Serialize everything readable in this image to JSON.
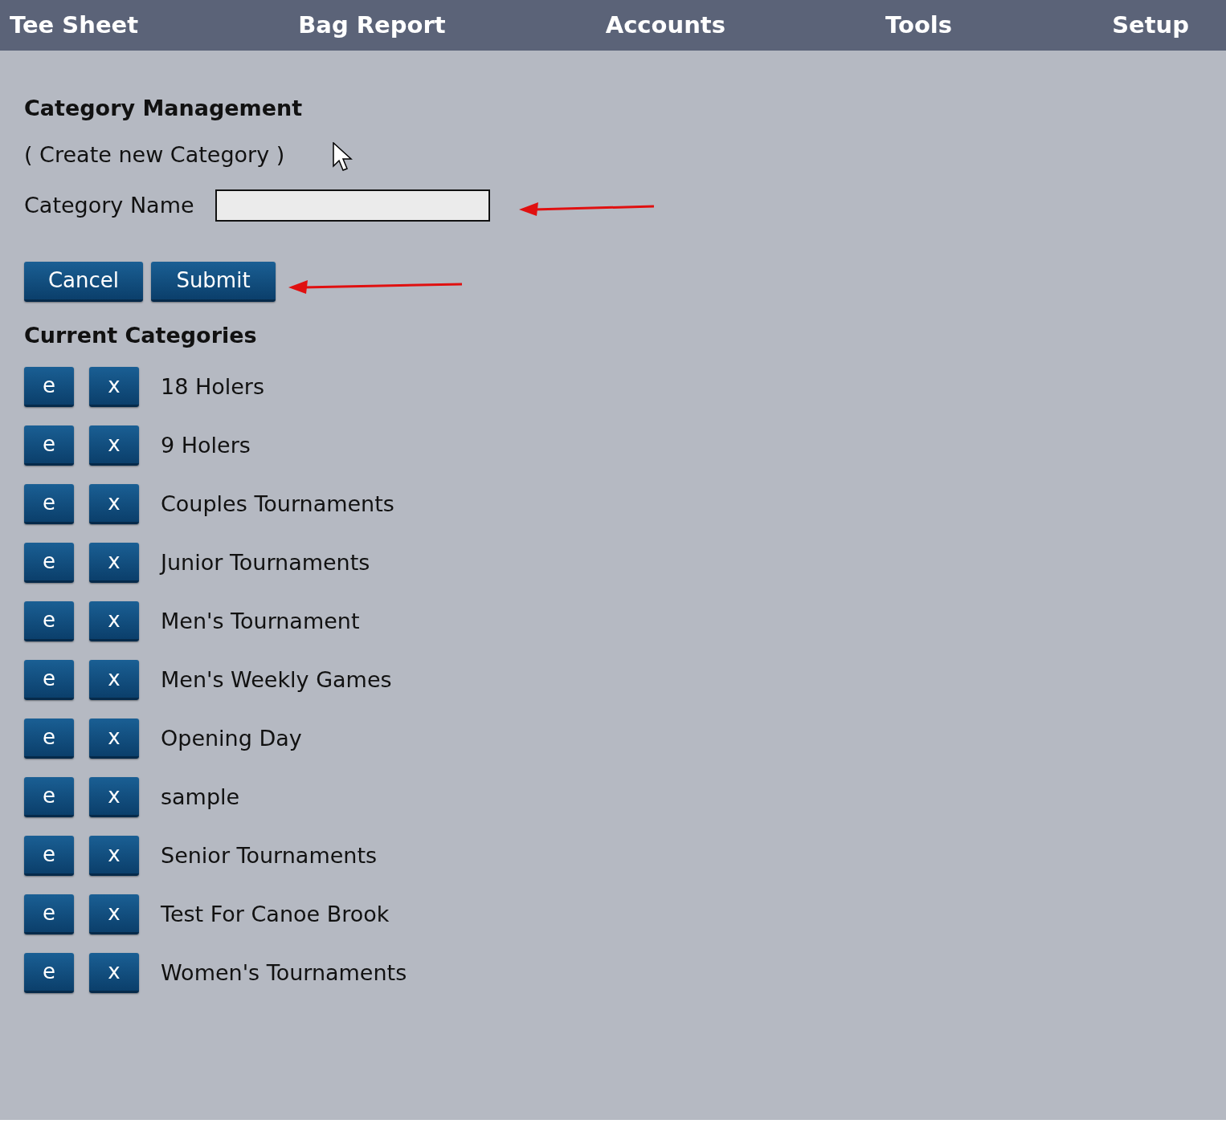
{
  "nav": [
    {
      "label": "Tee Sheet"
    },
    {
      "label": "Bag Report"
    },
    {
      "label": "Accounts"
    },
    {
      "label": "Tools"
    },
    {
      "label": "Setup"
    }
  ],
  "heading": "Category Management",
  "create_link": "( Create new Category )",
  "form": {
    "label": "Category Name"
  },
  "buttons": [
    {
      "label": "Cancel"
    },
    {
      "label": "Submit"
    }
  ],
  "categories_heading": "Current Categories",
  "categories": [
    {
      "edit": "e",
      "delete": "x",
      "name": "18 Holers"
    },
    {
      "edit": "e",
      "delete": "x",
      "name": "9 Holers"
    },
    {
      "edit": "e",
      "delete": "x",
      "name": "Couples Tournaments"
    },
    {
      "edit": "e",
      "delete": "x",
      "name": "Junior Tournaments"
    },
    {
      "edit": "e",
      "delete": "x",
      "name": "Men's Tournament"
    },
    {
      "edit": "e",
      "delete": "x",
      "name": "Men's Weekly Games"
    },
    {
      "edit": "e",
      "delete": "x",
      "name": "Opening Day"
    },
    {
      "edit": "e",
      "delete": "x",
      "name": "sample"
    },
    {
      "edit": "e",
      "delete": "x",
      "name": "Senior Tournaments"
    },
    {
      "edit": "e",
      "delete": "x",
      "name": "Test For Canoe Brook"
    },
    {
      "edit": "e",
      "delete": "x",
      "name": "Women's Tournaments"
    }
  ]
}
